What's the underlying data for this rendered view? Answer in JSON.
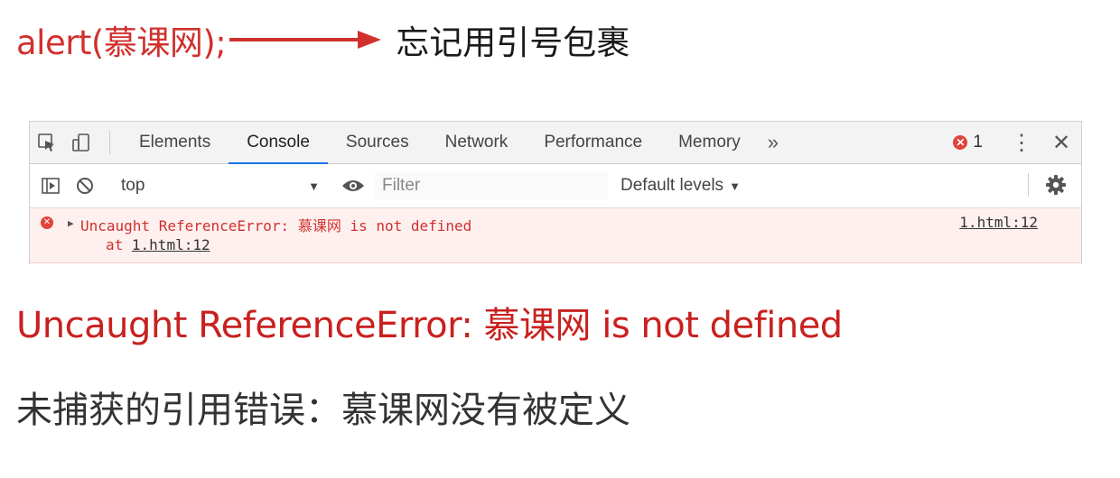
{
  "annotation": {
    "code": "alert(慕课网);",
    "note": "忘记用引号包裹",
    "arrow_color": "#d0312d"
  },
  "devtools": {
    "tabs": [
      {
        "label": "Elements",
        "active": false
      },
      {
        "label": "Console",
        "active": true
      },
      {
        "label": "Sources",
        "active": false
      },
      {
        "label": "Network",
        "active": false
      },
      {
        "label": "Performance",
        "active": false
      },
      {
        "label": "Memory",
        "active": false
      }
    ],
    "more_tabs_glyph": "»",
    "error_count": "1",
    "toolbar": {
      "context": "top",
      "filter_placeholder": "Filter",
      "levels_label": "Default levels"
    },
    "message": {
      "text": "Uncaught ReferenceError: 慕课网 is not defined",
      "stack_prefix": "at ",
      "stack_link": "1.html:12",
      "source": "1.html:12"
    },
    "colors": {
      "error_red": "#d0312d",
      "error_bg": "#fef0ef",
      "active_tab": "#1a73e8"
    }
  },
  "explanation": {
    "english": "Uncaught ReferenceError: 慕课网 is not defined",
    "chinese": "未捕获的引用错误：慕课网没有被定义"
  }
}
